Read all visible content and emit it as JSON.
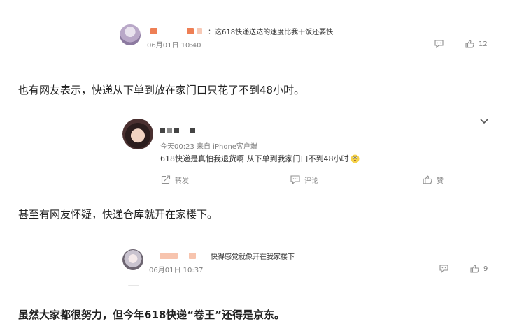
{
  "comment1": {
    "text": "：这618快递送达的速度比我干饭还要快",
    "time": "06月01日 10:40",
    "like_count": "12"
  },
  "para1": "也有网友表示，快递从下单到放在家门口只花了不到48小时。",
  "weibo_post": {
    "meta": "今天00:23  来自 iPhone客户端",
    "text": "618快递是真怕我退货啊 从下单到我家门口不到48小时",
    "repost_label": "转发",
    "comment_label": "评论",
    "like_label": "赞"
  },
  "para2": "甚至有网友怀疑，快递仓库就开在家楼下。",
  "comment2": {
    "text": "快得感觉就像开在我家楼下",
    "time": "06月01日 10:37",
    "like_count": "9"
  },
  "para3": "虽然大家都很努力，但今年618快递“卷王”还得是京东。",
  "colors": {
    "blur_orange": "#f0a080",
    "blur_dark": "#555555",
    "icon_gray": "#909090"
  }
}
